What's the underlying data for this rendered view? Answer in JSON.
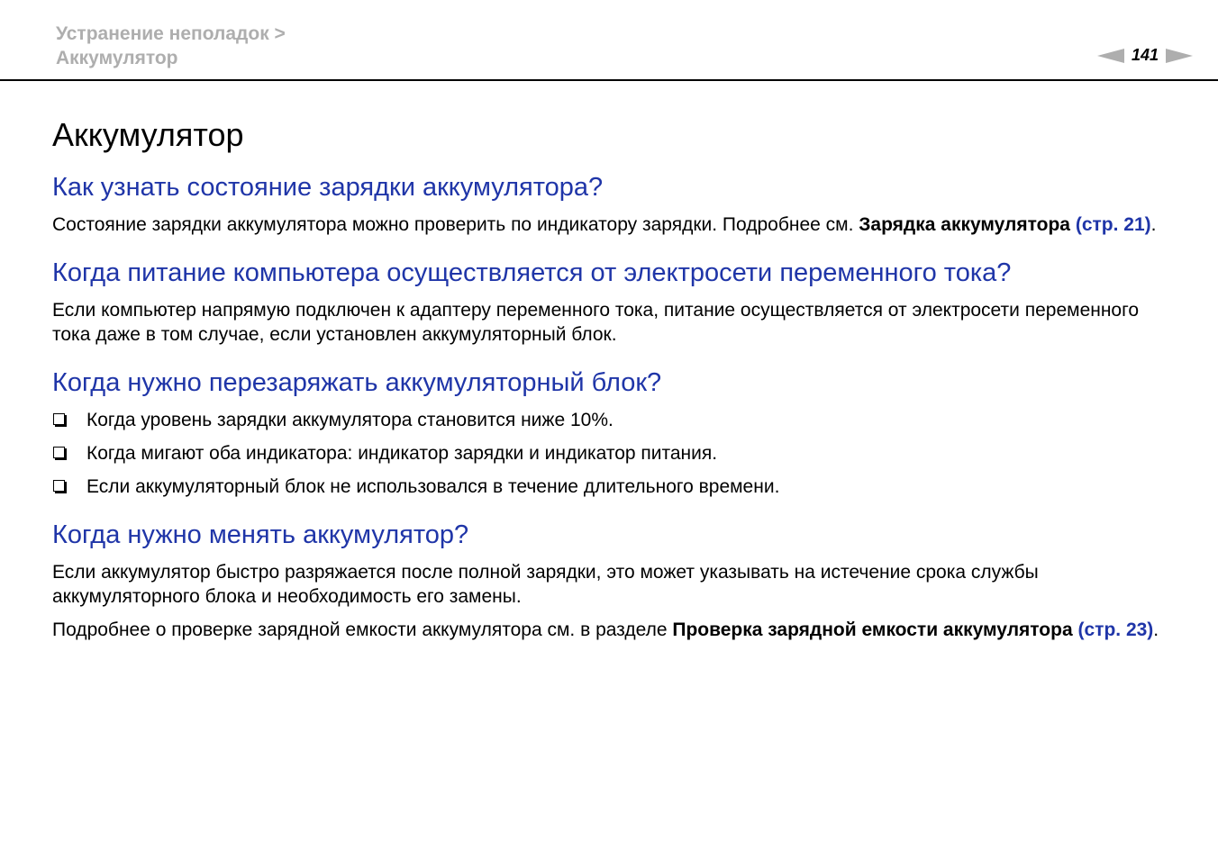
{
  "header": {
    "breadcrumb_line1": "Устранение неполадок >",
    "breadcrumb_line2": "Аккумулятор",
    "page_number": "141"
  },
  "title": "Аккумулятор",
  "sections": [
    {
      "heading": "Как узнать состояние зарядки аккумулятора?",
      "text": "Состояние зарядки аккумулятора можно проверить по индикатору зарядки. Подробнее см. ",
      "bold": "Зарядка аккумулятора",
      "link": "(стр. 21)",
      "end": "."
    },
    {
      "heading": "Когда питание компьютера осуществляется от электросети переменного тока?",
      "text": "Если компьютер напрямую подключен к адаптеру переменного тока, питание осуществляется от электросети переменного тока даже в том случае, если установлен аккумуляторный блок."
    },
    {
      "heading": "Когда нужно перезаряжать аккумуляторный блок?",
      "items": [
        "Когда уровень зарядки аккумулятора становится ниже 10%.",
        "Когда мигают оба индикатора: индикатор зарядки и индикатор питания.",
        "Если аккумуляторный блок не использовался в течение длительного времени."
      ]
    },
    {
      "heading": "Когда нужно менять аккумулятор?",
      "text": "Если аккумулятор быстро разряжается после полной зарядки, это может указывать на истечение срока службы аккумуляторного блока и необходимость его замены.",
      "text2": "Подробнее о проверке зарядной емкости аккумулятора см. в разделе ",
      "bold2": "Проверка зарядной емкости аккумулятора",
      "link2": "(стр. 23)",
      "end2": "."
    }
  ],
  "colors": {
    "heading_blue": "#1f35a8",
    "breadcrumb_gray": "#aeaeae"
  }
}
